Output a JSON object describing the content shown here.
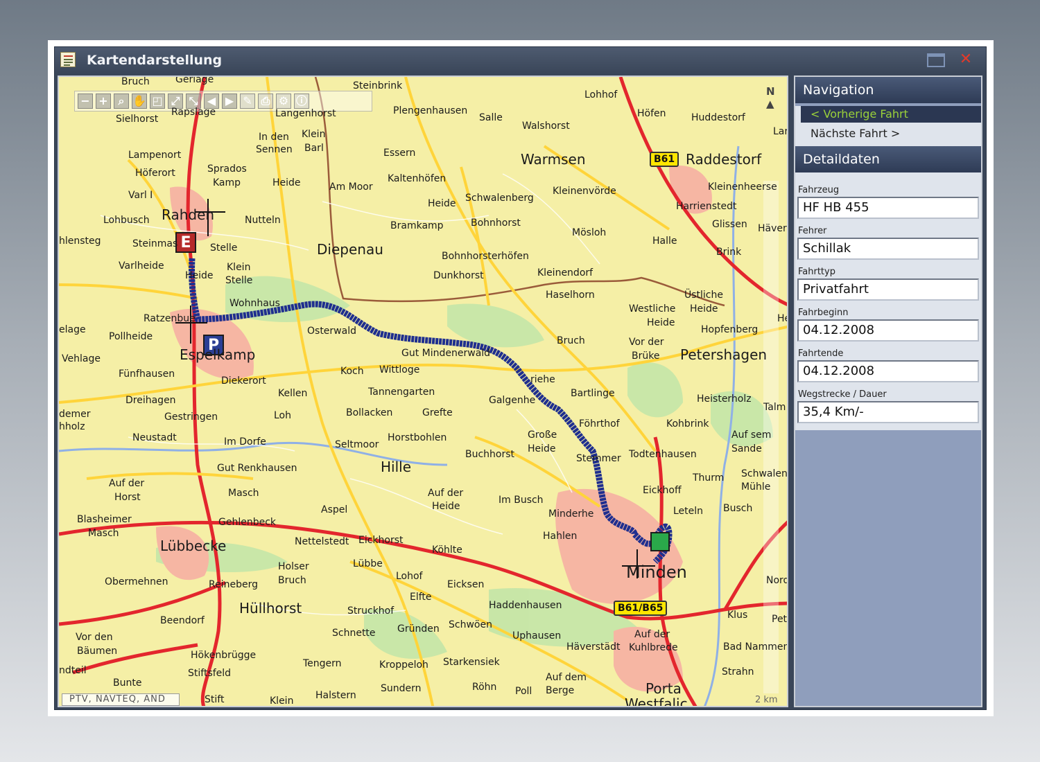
{
  "window": {
    "title": "Kartendarstellung"
  },
  "map": {
    "copyright": "PTV, NAVTEQ, AND",
    "north": "N",
    "scale": "2 km",
    "shields": [
      "B61",
      "B61/B65"
    ],
    "markers": {
      "start": "E",
      "parking": "P"
    },
    "places": {
      "bruch": "Bruch",
      "geriage": "Geriage",
      "steinbrink": "Steinbrink",
      "lohhof": "Lohhof",
      "rapslage": "Rapslage",
      "langenhorst": "Langenhorst",
      "plengenhausen": "Plengenhausen",
      "salle": "Salle",
      "hoefen": "Höfen",
      "huddestorf": "Huddestorf",
      "sielhorst": "Sielhorst",
      "walshorst": "Walshorst",
      "lar": "Lar",
      "inden": "In den",
      "sennen": "Sennen",
      "klein": "Klein",
      "barl": "Barl",
      "essern": "Essern",
      "lampenort": "Lampenort",
      "warmsen": "Warmsen",
      "raddestorf": "Raddestorf",
      "hoeferort": "Höferort",
      "sprados": "Sprados",
      "kamp": "Kamp",
      "heide1": "Heide",
      "ammoor": "Am Moor",
      "kaltenhoefen": "Kaltenhöfen",
      "kleinenheerse": "Kleinenheerse",
      "varl": "Varl I",
      "schwalenberg": "Schwalenberg",
      "kleinenvoerde": "Kleinenvörde",
      "harrienstedt": "Harrienstedt",
      "heide2": "Heide",
      "rahden": "Rahden",
      "lohbusch": "Lohbusch",
      "nutteln": "Nutteln",
      "bramkamp": "Bramkamp",
      "bohnhorst": "Bohnhorst",
      "glissen": "Glissen",
      "haever": "Häver",
      "moesloh": "Mösloh",
      "hlensteg": "hlensteg",
      "steinmas": "Steinmas",
      "stelle": "Stelle",
      "diepenau": "Diepenau",
      "halle": "Halle",
      "brink": "Brink",
      "bohnhorsterhoefen": "Bohnhorsterhöfen",
      "varlheide": "Varlheide",
      "kleinstelle1": "Klein",
      "kleinstelle2": "Stelle",
      "heide3": "Heide",
      "dunkhorst": "Dunkhorst",
      "kleinendorf": "Kleinendorf",
      "uestliche": "Üstliche",
      "heide4": "Heide",
      "wohnhaus": "Wohnhaus",
      "haselhorn": "Haselhorn",
      "westliche": "Westliche",
      "heide5": "Heide",
      "ratzenbue": "Ratzenbue",
      "he": "He",
      "elage": "elage",
      "pollheide": "Pollheide",
      "osterwald": "Osterwald",
      "hopfenberg": "Hopfenberg",
      "bruch2": "Bruch",
      "vorder": "Vor der",
      "bruek": "Brüke",
      "espelkamp": "Espelkamp",
      "vehlage": "Vehlage",
      "gutmindenerwald": "Gut Mindenerwald",
      "petershagen": "Petershagen",
      "koch": "Koch",
      "wittloge": "Wittloge",
      "fuenfhausen": "Fünfhausen",
      "diekerort": "Diekerort",
      "friehe": "riehe",
      "bartlinge": "Bartlinge",
      "kellen": "Kellen",
      "tannengarten": "Tannengarten",
      "heisterholz": "Heisterholz",
      "dreihagen": "Dreihagen",
      "galgenhe": "Galgenhe",
      "talm": "Talm",
      "demer": "demer",
      "gestringen": "Gestringen",
      "loh": "Loh",
      "bollacken": "Bollacken",
      "grefte": "Grefte",
      "kohbrink": "Kohbrink",
      "hholz": "hholz",
      "foehrthof": "Föhrthof",
      "neustadt": "Neustadt",
      "imdorfe": "Im Dorfe",
      "horstbohlen": "Horstbohlen",
      "seltmoor": "Seltmoor",
      "grosse": "Große",
      "heide6": "Heide",
      "aufsem": "Auf sem",
      "sande": "Sande",
      "buchhorst": "Buchhorst",
      "stemmer": "Stemmer",
      "todtenhausen": "Todtenhausen",
      "hille": "Hille",
      "gutrenkhausen": "Gut Renkhausen",
      "thurm": "Thurm",
      "schwalen": "Schwalen",
      "muehle": "Mühle",
      "aufder1": "Auf der",
      "horst": "Horst",
      "masch": "Masch",
      "aufder2": "Auf der",
      "heide7": "Heide",
      "eickhoff": "Eickhoff",
      "aspel": "Aspel",
      "imbusch": "Im Busch",
      "leteln": "Leteln",
      "busch": "Busch",
      "blasheimer": "Blasheimer",
      "masch2": "Masch",
      "gehlenbeck": "Gehlenbeck",
      "minderheide": "Minderhe",
      "hahlen": "Hahlen",
      "nettelstedt": "Nettelstedt",
      "eickhorst": "Eickhorst",
      "luebbecke": "Lübbecke",
      "koehlte": "Köhlte",
      "holser": "Holser",
      "bruch3": "Bruch",
      "luebbe": "Lübbe",
      "minden": "Minden",
      "lohof": "Lohof",
      "nord": "Nord",
      "obermehnen": "Obermehnen",
      "reineberg": "Reineberg",
      "eicksen": "Eicksen",
      "elfte": "Elfte",
      "haddenhausen": "Haddenhausen",
      "huellhorst": "Hüllhorst",
      "struckhof": "Struckhof",
      "klus": "Klus",
      "pet": "Pet",
      "beendorf": "Beendorf",
      "schnette": "Schnette",
      "gruenden": "Gründen",
      "schwoeen": "Schwöen",
      "uphausen": "Uphausen",
      "aufder3": "Auf der",
      "vorden": "Vor den",
      "baeumen": "Bäumen",
      "haeverstaedt": "Häverstädt",
      "kuhlbrede": "Kuhlbrede",
      "badnammen": "Bad Nammen",
      "hoekenbruegge": "Hökenbrügge",
      "ndteil": "ndteil",
      "tengern": "Tengern",
      "kroppeloh": "Kroppeloh",
      "starkensiek": "Starkensiek",
      "strahn": "Strahn",
      "stiftsfeld": "Stiftsfeld",
      "bunte": "Bunte",
      "aufdem": "Auf dem",
      "berge": "Berge",
      "roehn": "Röhn",
      "porta": "Porta",
      "westfalica": "Westfalic",
      "halstern": "Halstern",
      "sundern": "Sundern",
      "poll": "Poll",
      "stift": "Stift",
      "klein2": "Klein"
    }
  },
  "panel": {
    "navigation_header": "Navigation",
    "prev_trip": "< Vorherige Fahrt",
    "next_trip": "Nächste Fahrt >",
    "details_header": "Detaildaten",
    "fields": [
      {
        "label": "Fahrzeug",
        "value": "HF HB 455"
      },
      {
        "label": "Fehrer",
        "value": "Schillak"
      },
      {
        "label": "Fahrttyp",
        "value": "Privatfahrt"
      },
      {
        "label": "Fahrbeginn",
        "value": "04.12.2008"
      },
      {
        "label": "Fahrtende",
        "value": "04.12.2008"
      },
      {
        "label": "Wegstrecke / Dauer",
        "value": "35,4 Km/-"
      }
    ]
  },
  "colors": {
    "route": "#1f2f8f",
    "highway": "#e3262d",
    "road": "#ffd43a",
    "urban": "#f7b9a6",
    "forest": "#bfe3a4",
    "water": "#8fb0e6"
  }
}
